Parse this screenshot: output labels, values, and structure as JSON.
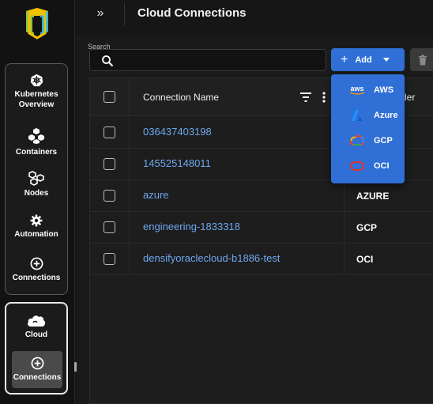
{
  "sidebar": {
    "items": [
      {
        "label": "Kubernetes Overview",
        "icon": "kubernetes-icon"
      },
      {
        "label": "Containers",
        "icon": "containers-icon"
      },
      {
        "label": "Nodes",
        "icon": "nodes-icon"
      },
      {
        "label": "Automation",
        "icon": "gear-icon"
      },
      {
        "label": "Connections",
        "icon": "plus-circle-icon"
      }
    ],
    "cloud_items": [
      {
        "label": "Cloud",
        "icon": "cloud-icon"
      },
      {
        "label": "Connections",
        "icon": "plus-circle-icon"
      }
    ]
  },
  "header": {
    "title": "Cloud Connections",
    "expand_icon": "»"
  },
  "search": {
    "label": "Search",
    "value": "",
    "placeholder": ""
  },
  "toolbar": {
    "add_label": "Add",
    "add_icon": "+"
  },
  "table": {
    "columns": [
      "Connection Name",
      "der"
    ],
    "rows": [
      {
        "name": "036437403198",
        "provider": ""
      },
      {
        "name": "145525148011",
        "provider": ""
      },
      {
        "name": "azure",
        "provider": "AZURE"
      },
      {
        "name": "engineering-1833318",
        "provider": "GCP"
      },
      {
        "name": "densifyoraclecloud-b1886-test",
        "provider": "OCI"
      }
    ]
  },
  "dropdown": {
    "items": [
      {
        "label": "AWS",
        "logo_text": "aws"
      },
      {
        "label": "Azure"
      },
      {
        "label": "GCP"
      },
      {
        "label": "OCI"
      }
    ]
  },
  "colors": {
    "accent": "#2f6fd6",
    "link": "#6ea8f0",
    "background": "#161616"
  }
}
